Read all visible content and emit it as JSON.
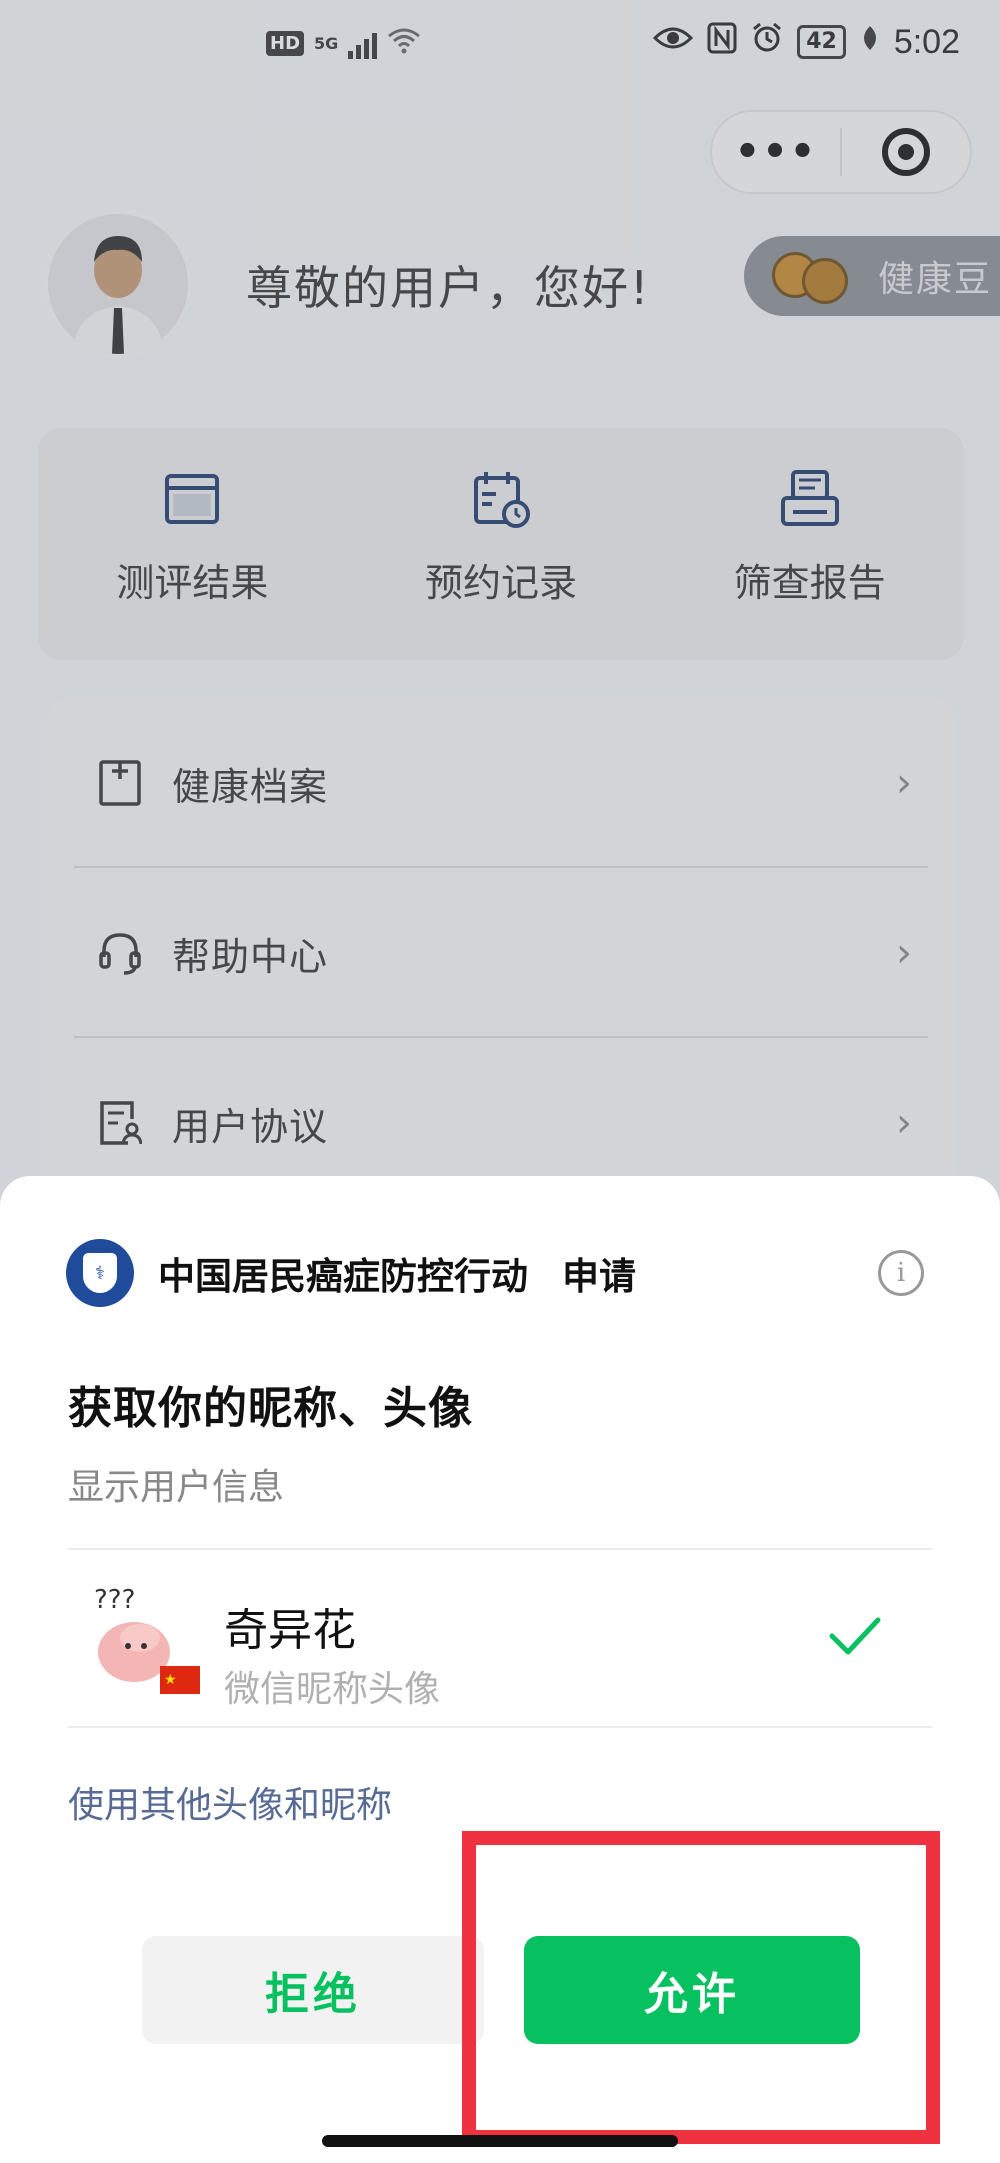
{
  "status_bar": {
    "hd": "HD",
    "network": "5G",
    "battery": "42",
    "time": "5:02"
  },
  "capsule": {
    "more": "•••"
  },
  "profile": {
    "greeting": "尊敬的用户，您好!",
    "bean_label": "健康豆"
  },
  "quick_actions": [
    {
      "label": "测评结果",
      "icon": "window-icon"
    },
    {
      "label": "预约记录",
      "icon": "calendar-clock-icon"
    },
    {
      "label": "筛查报告",
      "icon": "printer-report-icon"
    }
  ],
  "menu": [
    {
      "label": "健康档案",
      "icon": "archive-box-icon"
    },
    {
      "label": "帮助中心",
      "icon": "headset-icon"
    },
    {
      "label": "用户协议",
      "icon": "document-user-icon"
    }
  ],
  "sheet": {
    "app_name": "中国居民癌症防控行动",
    "apply": "申请",
    "info": "i",
    "title": "获取你的昵称、头像",
    "subtitle": "显示用户信息",
    "user_name": "奇异花",
    "user_desc": "微信昵称头像",
    "other_link": "使用其他头像和昵称",
    "reject": "拒绝",
    "allow": "允许"
  },
  "colors": {
    "wechat_green": "#07c160",
    "link_blue": "#576b95",
    "highlight_red": "#f0313f",
    "app_logo_blue": "#1f4b9a"
  }
}
